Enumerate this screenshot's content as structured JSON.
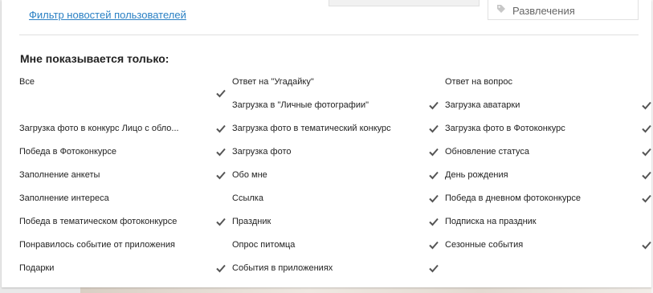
{
  "top": {
    "filter_link": "Фильтр новостей пользователей",
    "entertainment_label": "Развлечения",
    "entertainment_icon": "tag-icon"
  },
  "section": {
    "heading": "Мне показывается только:"
  },
  "items": [
    {
      "label": "Все",
      "checked": true
    },
    {
      "label": "Ответ на \"Угадайку\"",
      "checked": false
    },
    {
      "label": "Ответ на вопрос",
      "checked": false
    },
    {
      "label": "Загрузка в \"Личные фотографии\"",
      "checked": true
    },
    {
      "label": "Загрузка аватарки",
      "checked": true
    },
    {
      "label": "Загрузка фото в конкурс Лицо с обло...",
      "checked": true
    },
    {
      "label": "Загрузка фото в тематический конкурс",
      "checked": true
    },
    {
      "label": "Загрузка фото в Фотоконкурс",
      "checked": true
    },
    {
      "label": "Победа в Фотоконкурсе",
      "checked": true
    },
    {
      "label": "Загрузка фото",
      "checked": true
    },
    {
      "label": "Обновление статуса",
      "checked": true
    },
    {
      "label": "Заполнение анкеты",
      "checked": true
    },
    {
      "label": "Обо мне",
      "checked": true
    },
    {
      "label": "День рождения",
      "checked": true
    },
    {
      "label": "Заполнение интереса",
      "checked": false
    },
    {
      "label": "Ссылка",
      "checked": true
    },
    {
      "label": "Победа в дневном фотоконкурсе",
      "checked": true
    },
    {
      "label": "Победа в тематическом фотоконкурсе",
      "checked": true
    },
    {
      "label": "Праздник",
      "checked": true
    },
    {
      "label": "Подписка на праздник",
      "checked": false
    },
    {
      "label": "Понравилось событие от приложения",
      "checked": false
    },
    {
      "label": "Опрос питомца",
      "checked": true
    },
    {
      "label": "Сезонные события",
      "checked": true
    },
    {
      "label": "Подарки",
      "checked": true
    },
    {
      "label": "События в приложениях",
      "checked": true
    }
  ],
  "colors": {
    "link": "#2a80c4",
    "check": "#555555"
  },
  "check_icon": "checkmark-icon"
}
